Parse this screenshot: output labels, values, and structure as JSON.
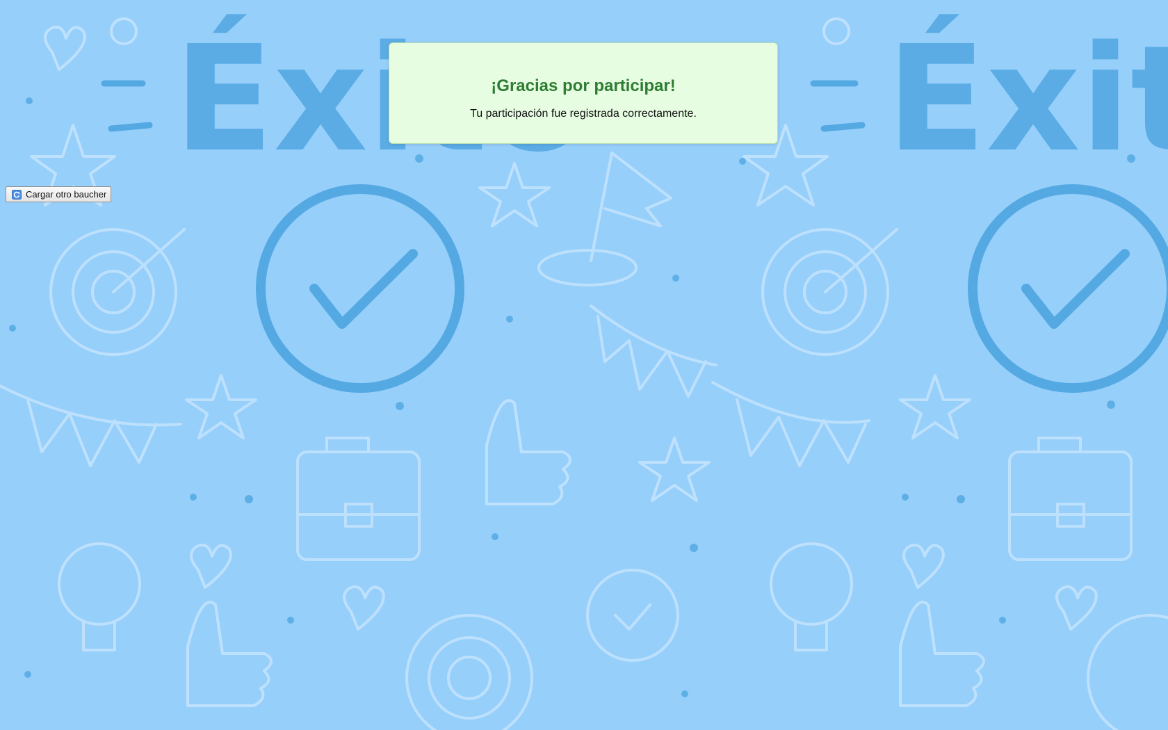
{
  "background": {
    "color": "#97cffb",
    "doodle_text": "Éxito",
    "accent": "#55a9e3"
  },
  "modal": {
    "title": "¡Gracias por participar!",
    "message": "Tu participación fue registrada correctamente.",
    "bg_color": "#e6fde2",
    "title_color": "#2e7d32"
  },
  "actions": {
    "reload_label": "Cargar otro baucher",
    "reload_icon": "refresh-icon"
  }
}
